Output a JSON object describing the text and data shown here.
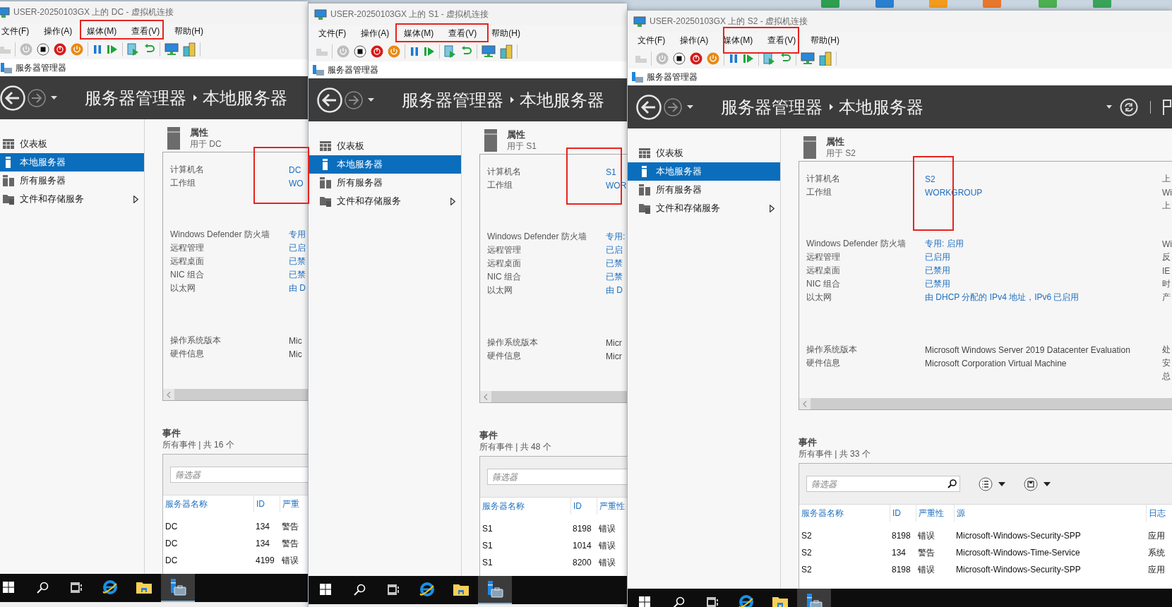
{
  "windows": [
    {
      "title": "USER-20250103GX 上的 DC - 虚拟机连接",
      "menu": [
        "文件(F)",
        "操作(A)",
        "媒体(M)",
        "查看(V)",
        "帮助(H)"
      ],
      "app_title": "服务器管理器",
      "breadcrumb": [
        "服务器管理器",
        "本地服务器"
      ],
      "sidebar": [
        {
          "label": "仪表板",
          "kind": "dashboard",
          "selected": false,
          "expandable": false
        },
        {
          "label": "本地服务器",
          "kind": "server",
          "selected": true,
          "expandable": false
        },
        {
          "label": "所有服务器",
          "kind": "servers",
          "selected": false,
          "expandable": false
        },
        {
          "label": "文件和存储服务",
          "kind": "storage",
          "selected": false,
          "expandable": true
        }
      ],
      "properties": {
        "heading": "属性",
        "subheading": "用于 DC",
        "groups": [
          [
            {
              "label": "计算机名",
              "value": "DC",
              "kind": "link"
            },
            {
              "label": "工作组",
              "value": "WO",
              "kind": "link"
            }
          ],
          [
            {
              "label": "Windows Defender 防火墙",
              "value": "专用",
              "kind": "link"
            },
            {
              "label": "远程管理",
              "value": "已启",
              "kind": "link"
            },
            {
              "label": "远程桌面",
              "value": "已禁",
              "kind": "link"
            },
            {
              "label": "NIC 组合",
              "value": "已禁",
              "kind": "link"
            },
            {
              "label": "以太网",
              "value": "由 D",
              "kind": "link"
            }
          ],
          [
            {
              "label": "操作系统版本",
              "value": "Mic",
              "kind": "text"
            },
            {
              "label": "硬件信息",
              "value": "Mic",
              "kind": "text"
            }
          ]
        ]
      },
      "events": {
        "heading": "事件",
        "summary": "所有事件 | 共 16 个",
        "filter": {
          "placeholder": "筛选器"
        },
        "columns": [
          "服务器名称",
          "ID",
          "严重"
        ],
        "rows": [
          [
            "DC",
            "134",
            "警告"
          ],
          [
            "DC",
            "134",
            "警告"
          ],
          [
            "DC",
            "4199",
            "错误"
          ]
        ]
      },
      "taskbar": [
        {
          "kind": "start",
          "selected": false
        },
        {
          "kind": "search",
          "selected": false
        },
        {
          "kind": "taskview",
          "selected": false
        },
        {
          "kind": "browser",
          "selected": false
        },
        {
          "kind": "explorer",
          "selected": false
        },
        {
          "kind": "servermanager",
          "selected": true
        }
      ]
    },
    {
      "title": "USER-20250103GX 上的 S1 - 虚拟机连接",
      "menu": [
        "文件(F)",
        "操作(A)",
        "媒体(M)",
        "查看(V)",
        "帮助(H)"
      ],
      "app_title": "服务器管理器",
      "breadcrumb": [
        "服务器管理器",
        "本地服务器"
      ],
      "sidebar": [
        {
          "label": "仪表板",
          "kind": "dashboard",
          "selected": false,
          "expandable": false
        },
        {
          "label": "本地服务器",
          "kind": "server",
          "selected": true,
          "expandable": false
        },
        {
          "label": "所有服务器",
          "kind": "servers",
          "selected": false,
          "expandable": false
        },
        {
          "label": "文件和存储服务",
          "kind": "storage",
          "selected": false,
          "expandable": true
        }
      ],
      "properties": {
        "heading": "属性",
        "subheading": "用于 S1",
        "groups": [
          [
            {
              "label": "计算机名",
              "value": "S1",
              "kind": "link"
            },
            {
              "label": "工作组",
              "value": "WOR",
              "kind": "link"
            }
          ],
          [
            {
              "label": "Windows Defender 防火墙",
              "value": "专用:",
              "kind": "link"
            },
            {
              "label": "远程管理",
              "value": "已启",
              "kind": "link"
            },
            {
              "label": "远程桌面",
              "value": "已禁",
              "kind": "link"
            },
            {
              "label": "NIC 组合",
              "value": "已禁",
              "kind": "link"
            },
            {
              "label": "以太网",
              "value": "由 D",
              "kind": "link"
            }
          ],
          [
            {
              "label": "操作系统版本",
              "value": "Micr",
              "kind": "text"
            },
            {
              "label": "硬件信息",
              "value": "Micr",
              "kind": "text"
            }
          ]
        ]
      },
      "events": {
        "heading": "事件",
        "summary": "所有事件 | 共 48 个",
        "filter": {
          "placeholder": "筛选器"
        },
        "columns": [
          "服务器名称",
          "ID",
          "严重性"
        ],
        "rows": [
          [
            "S1",
            "8198",
            "错误"
          ],
          [
            "S1",
            "1014",
            "错误"
          ],
          [
            "S1",
            "8200",
            "错误"
          ]
        ]
      },
      "taskbar": [
        {
          "kind": "start",
          "selected": false
        },
        {
          "kind": "search",
          "selected": false
        },
        {
          "kind": "taskview",
          "selected": false
        },
        {
          "kind": "browser",
          "selected": false
        },
        {
          "kind": "explorer",
          "selected": false
        },
        {
          "kind": "servermanager",
          "selected": true
        }
      ]
    },
    {
      "title": "USER-20250103GX 上的 S2 - 虚拟机连接",
      "menu": [
        "文件(F)",
        "操作(A)",
        "媒体(M)",
        "查看(V)",
        "帮助(H)"
      ],
      "app_title": "服务器管理器",
      "breadcrumb": [
        "服务器管理器",
        "本地服务器"
      ],
      "header_buttons": [
        {
          "kind": "dropdown"
        },
        {
          "kind": "refresh"
        },
        {
          "kind": "flag"
        }
      ],
      "sidebar": [
        {
          "label": "仪表板",
          "kind": "dashboard",
          "selected": false,
          "expandable": false
        },
        {
          "label": "本地服务器",
          "kind": "server",
          "selected": true,
          "expandable": false
        },
        {
          "label": "所有服务器",
          "kind": "servers",
          "selected": false,
          "expandable": false
        },
        {
          "label": "文件和存储服务",
          "kind": "storage",
          "selected": false,
          "expandable": true
        }
      ],
      "properties": {
        "heading": "属性",
        "subheading": "用于 S2",
        "groups": [
          [
            {
              "label": "计算机名",
              "value": "S2",
              "kind": "link",
              "side": "上"
            },
            {
              "label": "工作组",
              "value": "WORKGROUP",
              "kind": "link",
              "side": "Wi"
            },
            {
              "side": "上"
            }
          ],
          [
            {
              "label": "Windows Defender 防火墙",
              "value": "专用: 启用",
              "kind": "link",
              "side": "Wi"
            },
            {
              "label": "远程管理",
              "value": "已启用",
              "kind": "link",
              "side": "反"
            },
            {
              "label": "远程桌面",
              "value": "已禁用",
              "kind": "link",
              "side": "IE"
            },
            {
              "label": "NIC 组合",
              "value": "已禁用",
              "kind": "link",
              "side": "时"
            },
            {
              "label": "以太网",
              "value": "由 DHCP 分配的 IPv4 地址，IPv6 已启用",
              "kind": "link",
              "side": "产"
            }
          ],
          [
            {
              "label": "操作系统版本",
              "value": "Microsoft Windows Server 2019 Datacenter Evaluation",
              "kind": "text",
              "side": "处"
            },
            {
              "label": "硬件信息",
              "value": "Microsoft Corporation Virtual Machine",
              "kind": "text",
              "side": "安"
            },
            {
              "side": "总"
            }
          ]
        ]
      },
      "events": {
        "heading": "事件",
        "summary": "所有事件 | 共 33 个",
        "filter": {
          "placeholder": "筛选器",
          "search_icon": true
        },
        "tools": [
          {
            "kind": "list"
          },
          {
            "kind": "save"
          }
        ],
        "columns": [
          "服务器名称",
          "ID",
          "严重性",
          "源",
          "日志"
        ],
        "rows": [
          [
            "S2",
            "8198",
            "错误",
            "Microsoft-Windows-Security-SPP",
            "应用"
          ],
          [
            "S2",
            "134",
            "警告",
            "Microsoft-Windows-Time-Service",
            "系统"
          ],
          [
            "S2",
            "8198",
            "错误",
            "Microsoft-Windows-Security-SPP",
            "应用"
          ]
        ]
      },
      "taskbar": [
        {
          "kind": "start",
          "selected": false
        },
        {
          "kind": "search",
          "selected": false
        },
        {
          "kind": "taskview",
          "selected": false
        },
        {
          "kind": "browser",
          "selected": false
        },
        {
          "kind": "explorer",
          "selected": false
        },
        {
          "kind": "servermanager",
          "selected": true
        }
      ]
    }
  ]
}
